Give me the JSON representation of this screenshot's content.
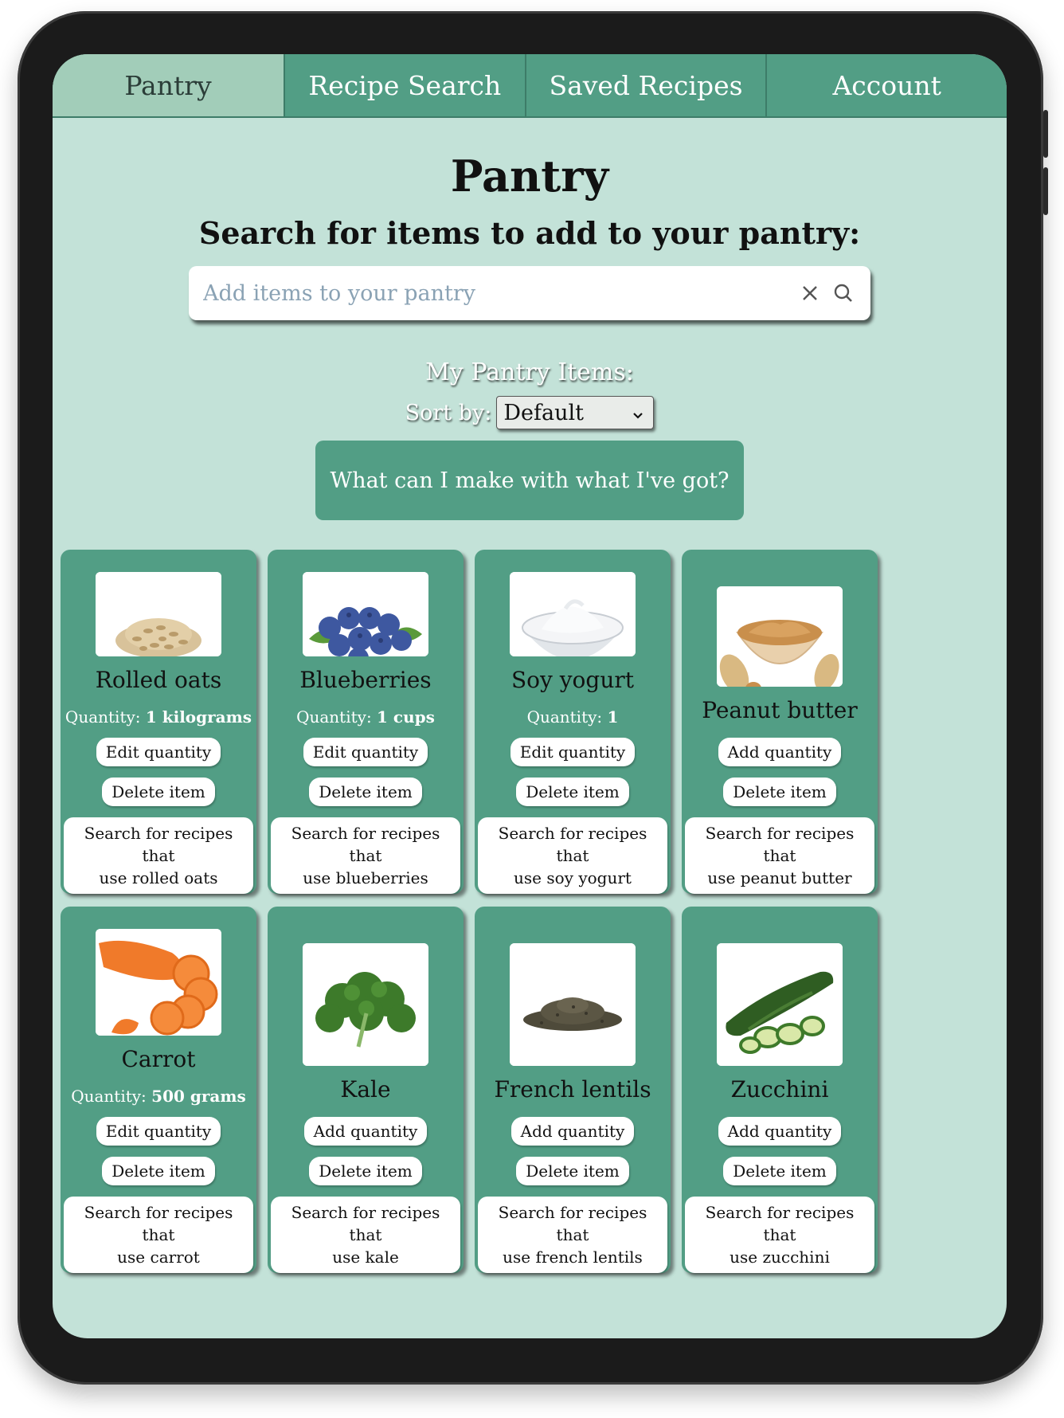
{
  "nav": {
    "tabs": [
      {
        "label": "Pantry",
        "active": true
      },
      {
        "label": "Recipe Search",
        "active": false
      },
      {
        "label": "Saved Recipes",
        "active": false
      },
      {
        "label": "Account",
        "active": false
      }
    ]
  },
  "page": {
    "title": "Pantry",
    "subtitle": "Search for items to add to your pantry:"
  },
  "search": {
    "placeholder": "Add items to your pantry",
    "value": ""
  },
  "pantry": {
    "heading": "My Pantry Items:",
    "sort_label": "Sort by:",
    "sort_value": "Default",
    "cta_label": "What can I make with what I've got?",
    "items": [
      {
        "name": "Rolled oats",
        "qty_label": "Quantity:",
        "qty": "1 kilograms",
        "edit_label": "Edit quantity",
        "delete_label": "Delete item",
        "search_line1": "Search for recipes that",
        "search_line2": "use rolled oats"
      },
      {
        "name": "Blueberries",
        "qty_label": "Quantity:",
        "qty": "1 cups",
        "edit_label": "Edit quantity",
        "delete_label": "Delete item",
        "search_line1": "Search for recipes that",
        "search_line2": "use blueberries"
      },
      {
        "name": "Soy yogurt",
        "qty_label": "Quantity:",
        "qty": "1",
        "edit_label": "Edit quantity",
        "delete_label": "Delete item",
        "search_line1": "Search for recipes that",
        "search_line2": "use soy yogurt"
      },
      {
        "name": "Peanut butter",
        "qty_label": "",
        "qty": "",
        "edit_label": "Add quantity",
        "delete_label": "Delete item",
        "search_line1": "Search for recipes that",
        "search_line2": "use peanut butter"
      },
      {
        "name": "Carrot",
        "qty_label": "Quantity:",
        "qty": "500 grams",
        "edit_label": "Edit quantity",
        "delete_label": "Delete item",
        "search_line1": "Search for recipes that",
        "search_line2": "use carrot"
      },
      {
        "name": "Kale",
        "qty_label": "",
        "qty": "",
        "edit_label": "Add quantity",
        "delete_label": "Delete item",
        "search_line1": "Search for recipes that",
        "search_line2": "use kale"
      },
      {
        "name": "French lentils",
        "qty_label": "",
        "qty": "",
        "edit_label": "Add quantity",
        "delete_label": "Delete item",
        "search_line1": "Search for recipes that",
        "search_line2": "use french lentils"
      },
      {
        "name": "Zucchini",
        "qty_label": "",
        "qty": "",
        "edit_label": "Add quantity",
        "delete_label": "Delete item",
        "search_line1": "Search for recipes that",
        "search_line2": "use zucchini"
      }
    ]
  },
  "colors": {
    "nav": "#529e85",
    "nav_active": "#a2cdb9",
    "background": "#c3e2d8",
    "card": "#529e85"
  },
  "icons": [
    "clear-icon",
    "search-icon",
    "chevron-down-icon"
  ]
}
